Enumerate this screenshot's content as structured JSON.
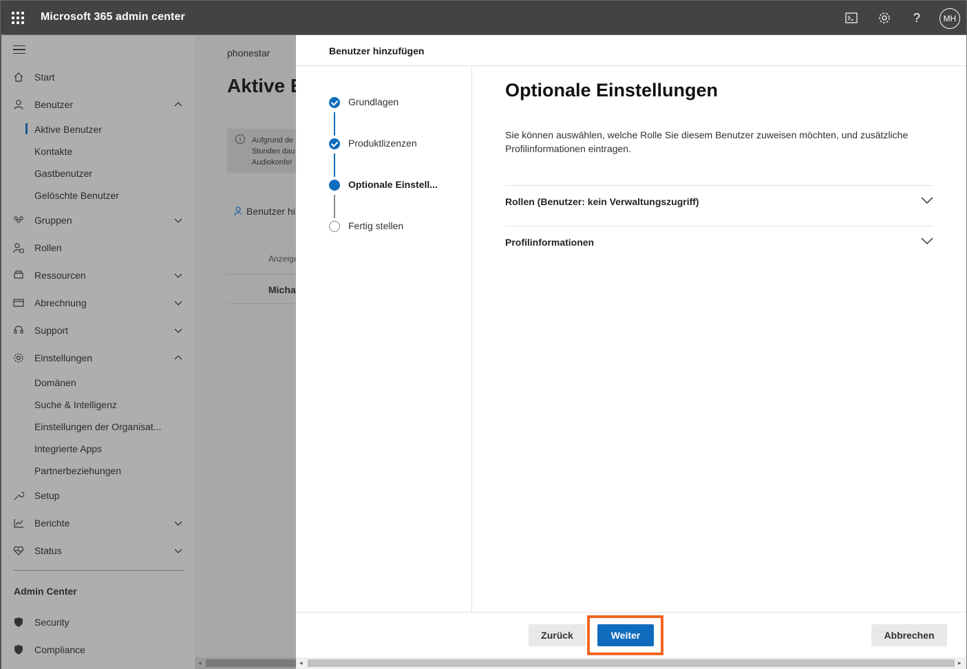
{
  "app": {
    "title": "Microsoft 365 admin center",
    "avatar_initials": "MH"
  },
  "topbar": {
    "icons": [
      "terminal-icon",
      "gear-icon",
      "help-icon"
    ]
  },
  "nav": {
    "items": [
      {
        "label": "Start",
        "icon": "home-icon"
      },
      {
        "label": "Benutzer",
        "icon": "user-icon"
      },
      {
        "label": "Gruppen",
        "icon": "groups-icon"
      },
      {
        "label": "Rollen",
        "icon": "roles-icon"
      },
      {
        "label": "Ressourcen",
        "icon": "resources-icon"
      },
      {
        "label": "Abrechnung",
        "icon": "billing-icon"
      },
      {
        "label": "Support",
        "icon": "support-icon"
      },
      {
        "label": "Einstellungen",
        "icon": "settings-icon"
      },
      {
        "label": "Setup",
        "icon": "wrench-icon"
      },
      {
        "label": "Berichte",
        "icon": "chart-icon"
      },
      {
        "label": "Status",
        "icon": "health-icon"
      }
    ],
    "user_subitems": [
      "Aktive Benutzer",
      "Kontakte",
      "Gastbenutzer",
      "Gelöschte Benutzer"
    ],
    "settings_subitems": [
      "Domänen",
      "Suche & Intelligenz",
      "Einstellungen der Organisat...",
      "Integrierte Apps",
      "Partnerbeziehungen"
    ],
    "admin_section": "Admin Center",
    "admin_items": [
      "Security",
      "Compliance"
    ]
  },
  "background": {
    "org": "phonestar",
    "title": "Aktive E",
    "info_text": "Aufgrund de\nStunden dau\nAudiokonfer",
    "add_user": "Benutzer hi",
    "column": "Anzeige",
    "row": "Micha"
  },
  "panel": {
    "header": "Benutzer hinzufügen",
    "steps": [
      {
        "label": "Grundlagen",
        "state": "done"
      },
      {
        "label": "Produktlizenzen",
        "state": "done"
      },
      {
        "label": "Optionale Einstell...",
        "state": "current"
      },
      {
        "label": "Fertig stellen",
        "state": "todo"
      }
    ],
    "title": "Optionale Einstellungen",
    "description": "Sie können auswählen, welche Rolle Sie diesem Benutzer zuweisen möchten, und zusätzliche Profilinformationen eintragen.",
    "sections": [
      "Rollen (Benutzer: kein Verwaltungszugriff)",
      "Profilinformationen"
    ],
    "buttons": {
      "back": "Zurück",
      "next": "Weiter",
      "cancel": "Abbrechen"
    }
  },
  "colors": {
    "accent": "#0f6cbd",
    "highlight": "#f26522",
    "topbar": "#444342"
  }
}
